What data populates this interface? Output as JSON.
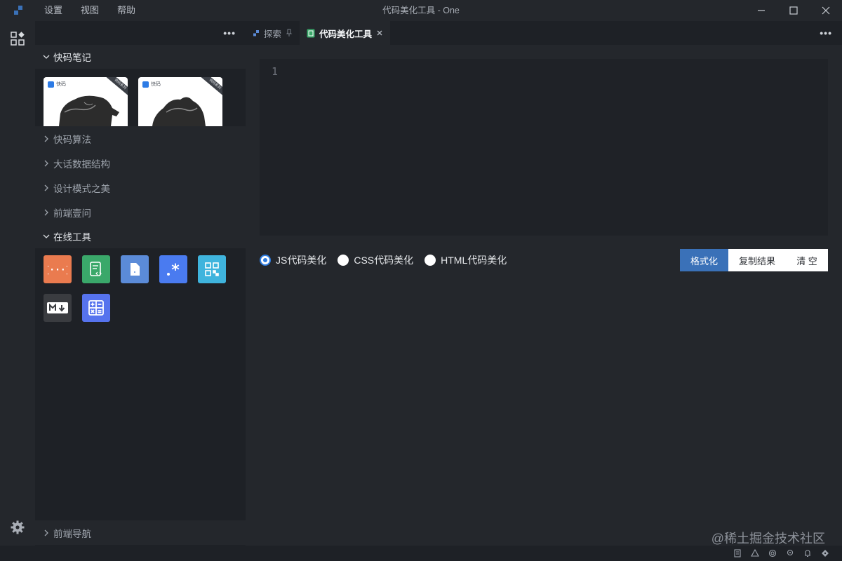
{
  "menu": [
    "设置",
    "视图",
    "帮助"
  ],
  "window_title": "代码美化工具 - One",
  "sidebar": {
    "sections": [
      {
        "label": "快码笔记",
        "expanded": true
      },
      {
        "label": "快码算法",
        "expanded": false
      },
      {
        "label": "大话数据结构",
        "expanded": false
      },
      {
        "label": "设计模式之美",
        "expanded": false
      },
      {
        "label": "前端壹问",
        "expanded": false
      },
      {
        "label": "在线工具",
        "expanded": true
      },
      {
        "label": "前端导航",
        "expanded": false
      }
    ],
    "cards": [
      {
        "brand": "快码",
        "ribbon": "快码系列"
      },
      {
        "brand": "快码",
        "ribbon": "快码系列"
      }
    ],
    "tools": [
      {
        "icon": "json-braces-icon",
        "color": "#ea7b4f"
      },
      {
        "icon": "code-file-icon",
        "color": "#3aa86a"
      },
      {
        "icon": "document-icon",
        "color": "#5b8bd8"
      },
      {
        "icon": "regex-icon",
        "color": "#4a7bf0"
      },
      {
        "icon": "qr-code-icon",
        "color": "#3fb4dd"
      },
      {
        "icon": "markdown-icon",
        "color": "#3a3c40"
      },
      {
        "icon": "calculator-icon",
        "color": "#5673ee"
      }
    ]
  },
  "tabs": [
    {
      "label": "探索",
      "active": false
    },
    {
      "label": "代码美化工具",
      "active": true
    }
  ],
  "editor": {
    "line_number": "1"
  },
  "options": [
    {
      "label": "JS代码美化",
      "checked": true
    },
    {
      "label": "CSS代码美化",
      "checked": false
    },
    {
      "label": "HTML代码美化",
      "checked": false
    }
  ],
  "buttons": {
    "format": "格式化",
    "copy": "复制结果",
    "clear": "清 空"
  },
  "watermark": "@稀土掘金技术社区",
  "colors": {
    "accent": "#3a71b8",
    "radio": "#2f7de1"
  }
}
